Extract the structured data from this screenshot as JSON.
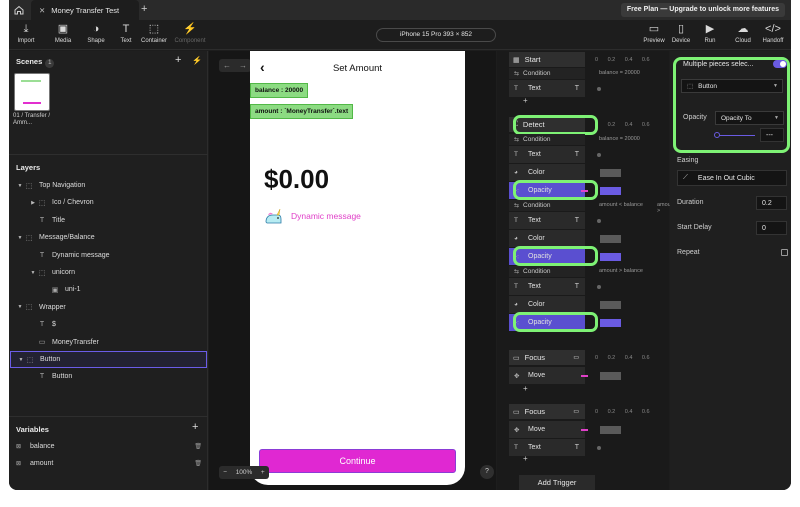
{
  "tabbar": {
    "tab_title": "Money Transfer Test",
    "upgrade": "Free Plan — Upgrade to unlock more features"
  },
  "toolbar": {
    "left_tools": [
      {
        "label": "Import",
        "icon": "import-icon",
        "glyph": "⤓"
      },
      {
        "label": "Media",
        "icon": "media-icon",
        "glyph": "▣"
      },
      {
        "label": "Shape",
        "icon": "shape-icon",
        "glyph": "◑"
      },
      {
        "label": "Text",
        "icon": "text-icon",
        "glyph": "T"
      },
      {
        "label": "Container",
        "icon": "container-icon",
        "glyph": "⬚"
      },
      {
        "label": "Component",
        "icon": "component-icon",
        "glyph": "⚡"
      }
    ],
    "device": "iPhone 15 Pro  393 × 852",
    "right_tools": [
      {
        "label": "Preview",
        "icon": "preview-icon",
        "glyph": "▭"
      },
      {
        "label": "Device",
        "icon": "device-icon",
        "glyph": "▯"
      },
      {
        "label": "Run",
        "icon": "run-icon",
        "glyph": "▶"
      },
      {
        "label": "Cloud",
        "icon": "cloud-icon",
        "glyph": "☁"
      },
      {
        "label": "Handoff",
        "icon": "handoff-icon",
        "glyph": "</>"
      }
    ]
  },
  "scenes": {
    "title": "Scenes",
    "count": "1",
    "scene_label": "01 / Transfer / Amm..."
  },
  "layers": {
    "title": "Layers",
    "items": [
      {
        "label": "Top Navigation",
        "type": "container",
        "indent": 0,
        "caret": "▼"
      },
      {
        "label": "Ico / Chevron",
        "type": "container",
        "indent": 1,
        "caret": "▶"
      },
      {
        "label": "Title",
        "type": "text",
        "indent": 1,
        "caret": ""
      },
      {
        "label": "Message/Balance",
        "type": "container",
        "indent": 0,
        "caret": "▼"
      },
      {
        "label": "Dynamic message",
        "type": "text",
        "indent": 1,
        "caret": ""
      },
      {
        "label": "unicorn",
        "type": "container",
        "indent": 1,
        "caret": "▼"
      },
      {
        "label": "uni-1",
        "type": "image",
        "indent": 2,
        "caret": ""
      },
      {
        "label": "Wrapper",
        "type": "container",
        "indent": 0,
        "caret": "▼"
      },
      {
        "label": "$",
        "type": "text",
        "indent": 1,
        "caret": ""
      },
      {
        "label": "MoneyTransfer",
        "type": "input",
        "indent": 1,
        "caret": ""
      },
      {
        "label": "Button",
        "type": "container",
        "indent": 0,
        "caret": "▼",
        "selected": true
      },
      {
        "label": "Button",
        "type": "text",
        "indent": 1,
        "caret": ""
      }
    ]
  },
  "variables": {
    "title": "Variables",
    "items": [
      {
        "label": "balance"
      },
      {
        "label": "amount"
      }
    ]
  },
  "canvas": {
    "screen_title": "Set Amount",
    "tag_balance": "balance : 20000",
    "tag_amount": "amount : `MoneyTransfer`.text",
    "amount_text": "$0.00",
    "dynamic_message": "Dynamic message",
    "continue_label": "Continue",
    "zoom": "100%",
    "help": "?"
  },
  "timeline": {
    "ruler": "0  0.2  0.4  0.6",
    "start": "Start",
    "detect": "Detect",
    "condition": "Condition",
    "text": "Text",
    "color": "Color",
    "opacity": "Opacity",
    "focus": "Focus",
    "move": "Move",
    "cond_1": "balance = 20000",
    "cond_2": "balance = 20000",
    "cond_3": "amount < balance",
    "cond_3b": "amount >",
    "cond_4": "amount > balance",
    "add_trigger": "Add Trigger"
  },
  "props": {
    "multi_select": "Multiple pieces selec...",
    "target": "Button",
    "opacity_label": "Opacity",
    "opacity_select": "Opacity To",
    "opacity_value": "---",
    "easing_label": "Easing",
    "easing_value": "Ease In Out Cubic",
    "duration_label": "Duration",
    "duration_value": "0.2",
    "delay_label": "Start Delay",
    "delay_value": "0",
    "repeat_label": "Repeat"
  },
  "colors": {
    "accent": "#6a5be2",
    "highlight": "#7ef275",
    "button_pink": "#e028d2",
    "tag_green": "#8cdb82"
  }
}
